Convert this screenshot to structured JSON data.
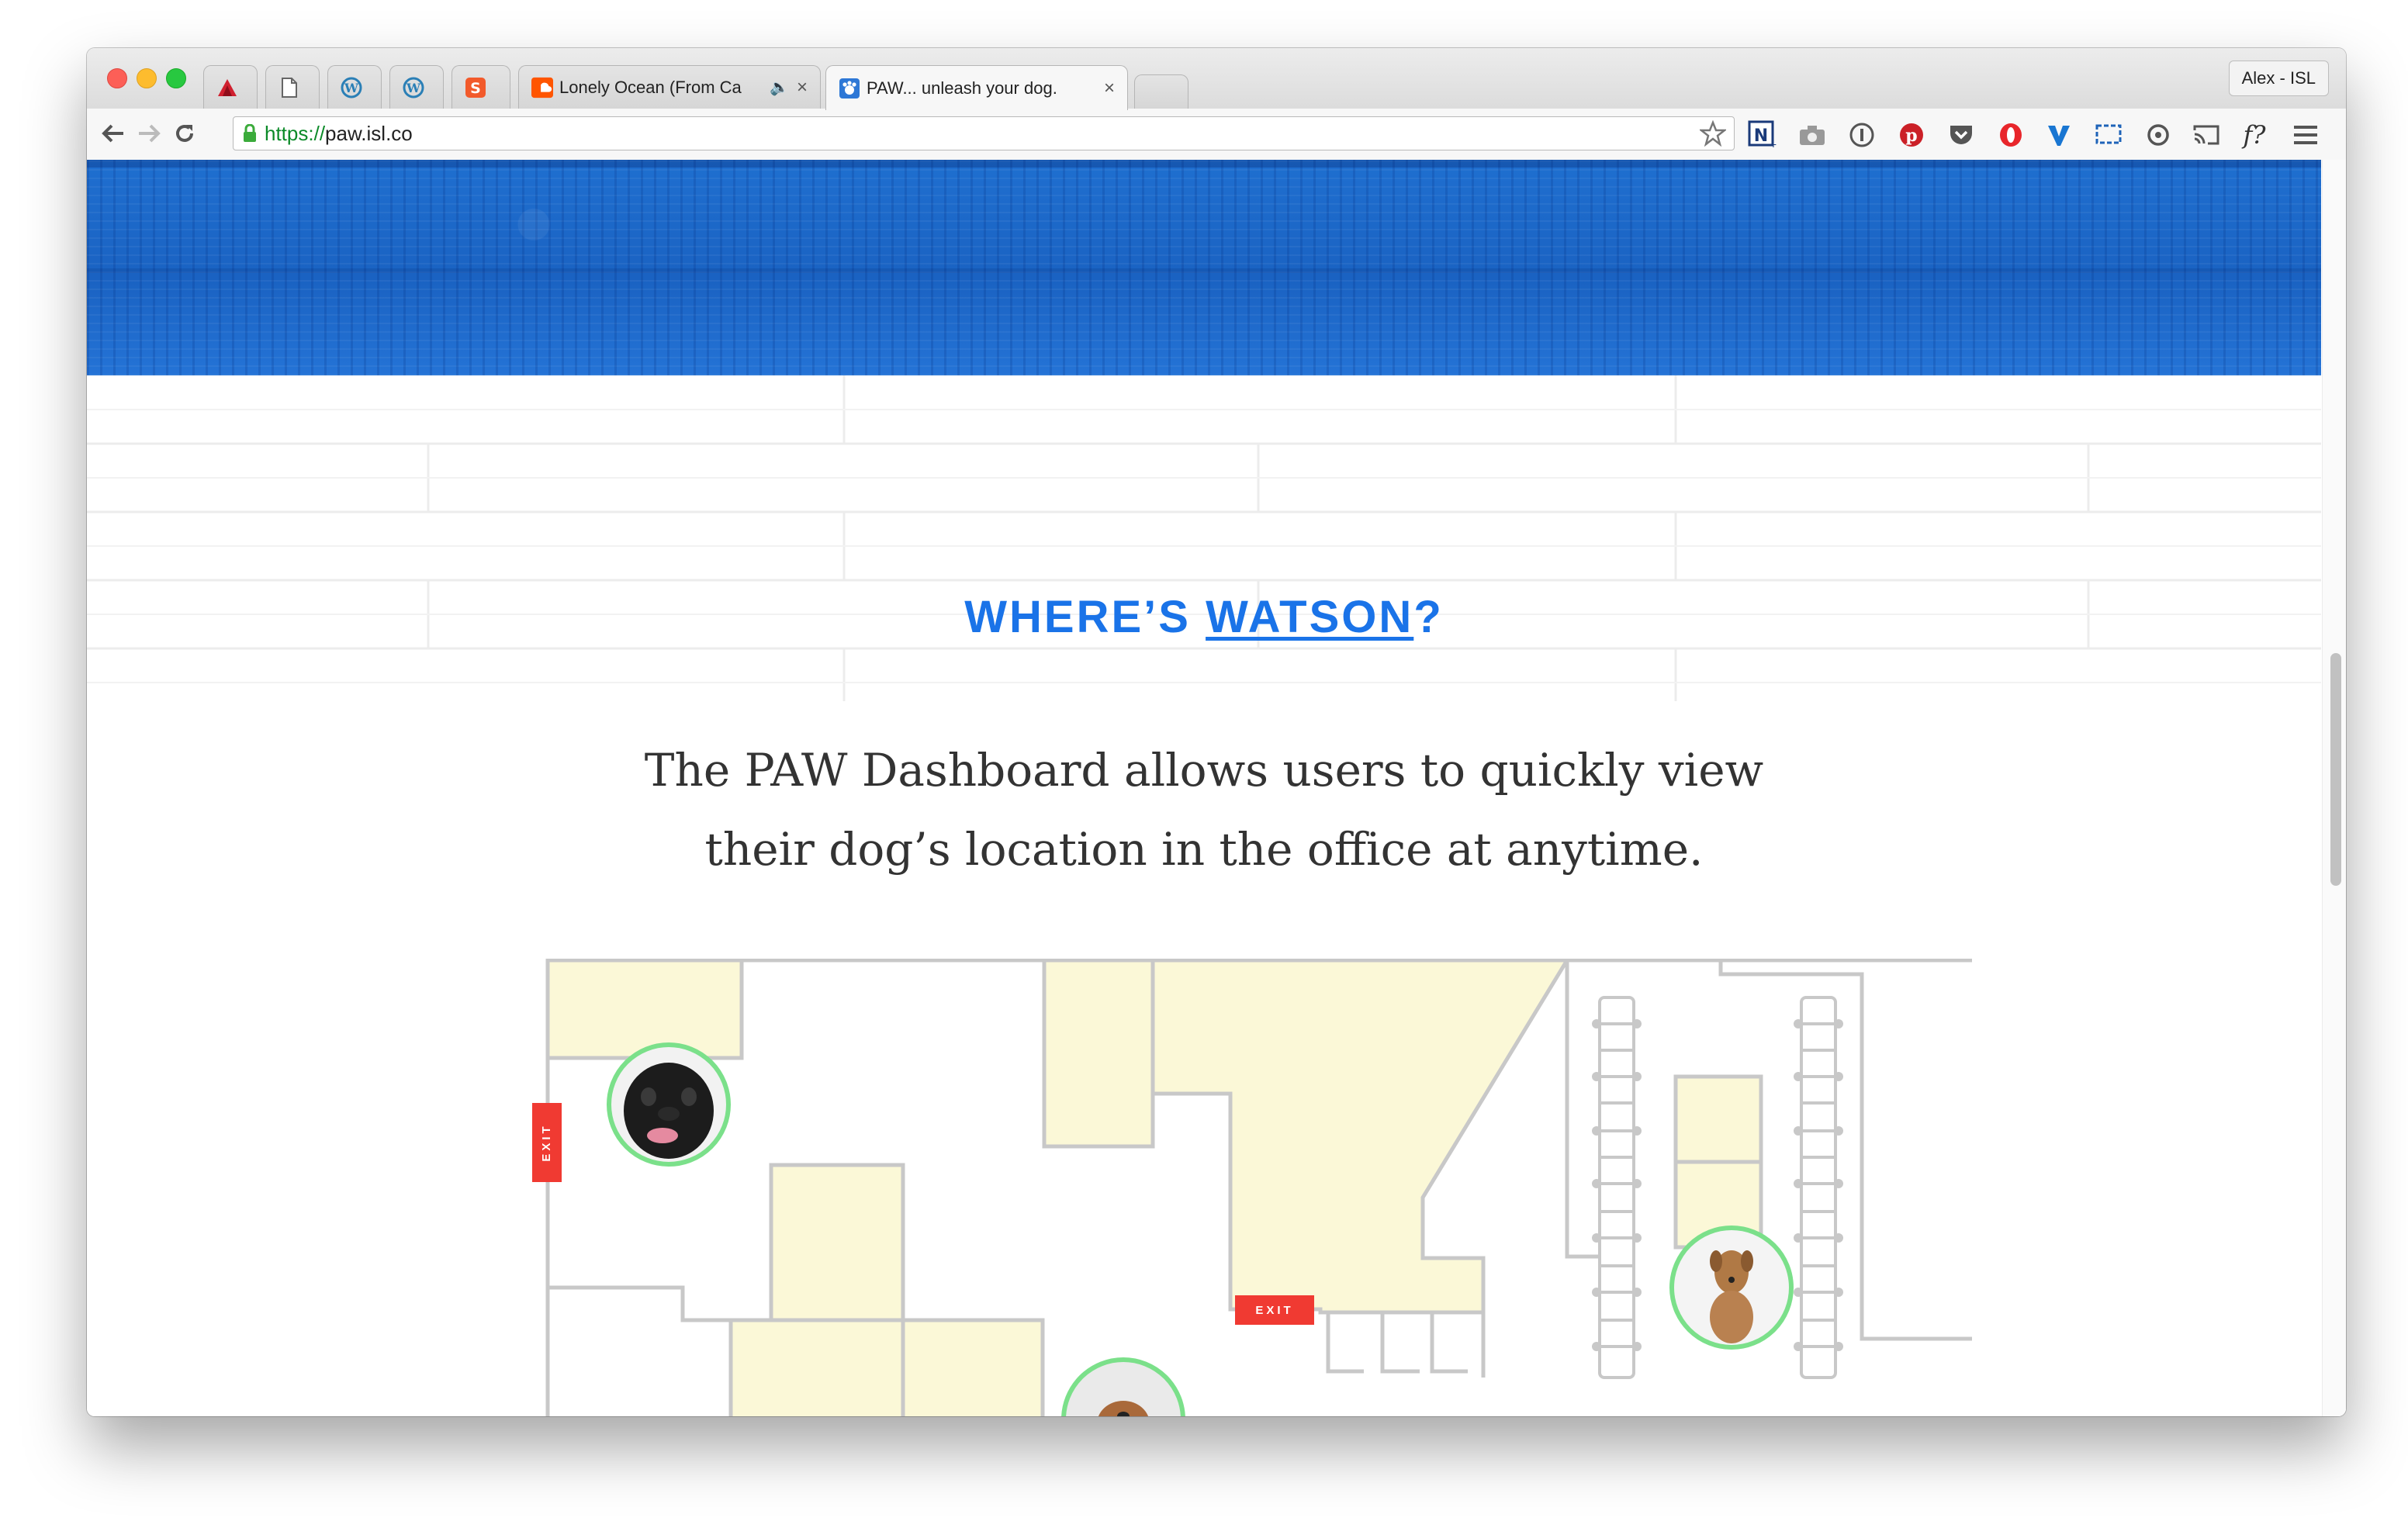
{
  "browser": {
    "tabs": [
      {
        "title": "",
        "icon": "delta-icon"
      },
      {
        "title": "",
        "icon": "blank-page-icon"
      },
      {
        "title": "",
        "icon": "wordpress-icon"
      },
      {
        "title": "",
        "icon": "wordpress-icon"
      },
      {
        "title": "",
        "icon": "s-app-icon"
      },
      {
        "title": "Lonely Ocean (From Ca",
        "icon": "soundcloud-icon",
        "audio": true
      },
      {
        "title": "PAW... unleash your dog.",
        "icon": "paw-favicon",
        "active": true
      }
    ],
    "profile": "Alex - ISL",
    "url_scheme": "https://",
    "url_host": "paw.isl.co",
    "extensions": [
      "star-icon",
      "n-ext-icon",
      "camera-icon",
      "onepassword-icon",
      "pinterest-icon",
      "pocket-icon",
      "opera-icon",
      "v-ext-icon",
      "screen-ext-icon",
      "sync-ext-icon",
      "cast-icon",
      "f-question-icon",
      "menu-icon"
    ],
    "extension_fq": "f?"
  },
  "page": {
    "heading_prefix": "WHERE’S ",
    "heading_link": "WATSON",
    "heading_suffix": "?",
    "body": "The PAW Dashboard allows users to quickly view their dog’s location in the office at anytime.",
    "exit_label": "EXIT"
  },
  "colors": {
    "accent": "#1a73e8",
    "room_fill": "#fbf8d7",
    "wall": "#c8c8c8",
    "exit": "#f03a32",
    "dog_ring": "#7be08a"
  }
}
